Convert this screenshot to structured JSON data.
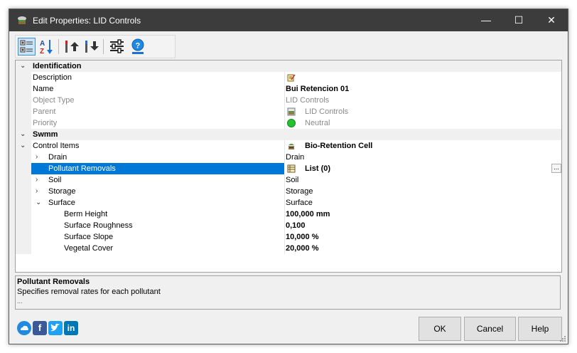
{
  "window": {
    "title": "Edit Properties: LID Controls",
    "minimize": "—",
    "maximize": "☐",
    "close": "✕"
  },
  "toolbar": {
    "buttons": [
      "categorized-view",
      "sort-alphabetical",
      "move-up",
      "move-down",
      "settings",
      "help"
    ]
  },
  "grid": {
    "categories": {
      "identification": "Identification",
      "swmm": "Swmm"
    },
    "rows": {
      "description": {
        "name": "Description",
        "value": ""
      },
      "name": {
        "name": "Name",
        "value": "Bui Retencion 01"
      },
      "object_type": {
        "name": "Object Type",
        "value": "LID Controls"
      },
      "parent": {
        "name": "Parent",
        "value": "LID Controls"
      },
      "priority": {
        "name": "Priority",
        "value": "Neutral"
      },
      "control_items": {
        "name": "Control Items",
        "value": "Bio-Retention Cell"
      },
      "drain": {
        "name": "Drain",
        "value": "Drain"
      },
      "pollutant_removals": {
        "name": "Pollutant Removals",
        "value": "List (0)",
        "button": "..."
      },
      "soil": {
        "name": "Soil",
        "value": "Soil"
      },
      "storage": {
        "name": "Storage",
        "value": "Storage"
      },
      "surface": {
        "name": "Surface",
        "value": "Surface"
      },
      "berm_height": {
        "name": "Berm Height",
        "value": "100,000 mm"
      },
      "surface_roughness": {
        "name": "Surface Roughness",
        "value": "0,100"
      },
      "surface_slope": {
        "name": "Surface Slope",
        "value": "10,000 %"
      },
      "vegetal_cover": {
        "name": "Vegetal Cover",
        "value": "20,000 %"
      }
    }
  },
  "description_panel": {
    "title": "Pollutant Removals",
    "text": "Specifies removal rates for each pollutant",
    "more": "..."
  },
  "social": {
    "f": "f",
    "in": "in"
  },
  "buttons": {
    "ok": "OK",
    "cancel": "Cancel",
    "help": "Help"
  },
  "colors": {
    "titlebar": "#3c3c3c",
    "selection": "#0078d7",
    "priority_dot": "#22c32e"
  }
}
